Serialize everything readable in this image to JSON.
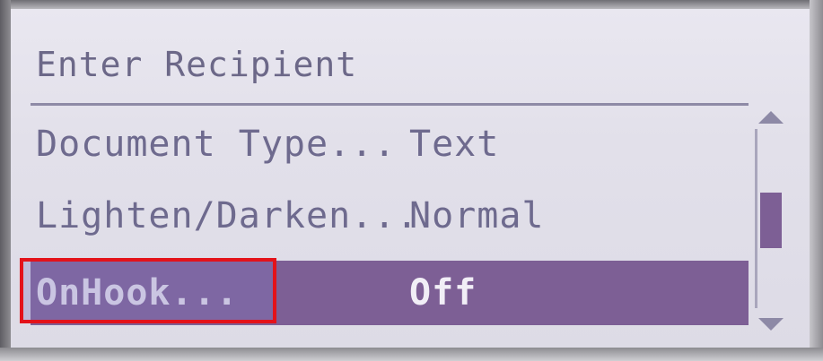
{
  "screen": {
    "header": "Enter Recipient",
    "rows": [
      {
        "label": "Document Type...",
        "value": "Text",
        "selected": false
      },
      {
        "label": "Lighten/Darken...",
        "value": "Normal",
        "selected": false
      },
      {
        "label": "OnHook...",
        "value": "Off",
        "selected": true
      }
    ]
  },
  "scrollbar": {
    "up_icon": "triangle-up-icon",
    "down_icon": "triangle-down-icon"
  },
  "colors": {
    "lcd_background": "#e2e0ea",
    "text": "#6e6a8e",
    "selection": "#7d5f95",
    "annotation_box": "#e3121a"
  }
}
